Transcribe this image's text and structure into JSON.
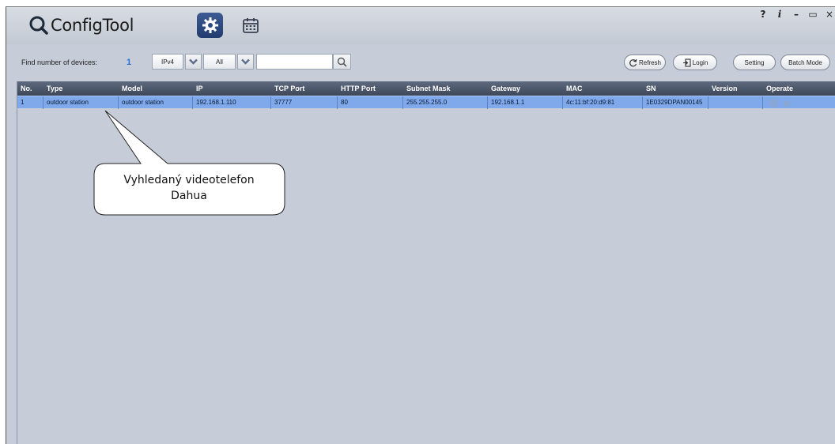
{
  "app": {
    "title": "ConfigTool",
    "window_controls": [
      "?",
      "i",
      "–",
      "▭",
      "×"
    ]
  },
  "toolbar": {
    "find_label": "Find number of devices:",
    "find_count": "1",
    "ip_type": "IPv4",
    "filter": "All",
    "search_value": "",
    "buttons": {
      "refresh": "Refresh",
      "login": "Login",
      "setting": "Setting",
      "batch_mode": "Batch Mode"
    }
  },
  "table": {
    "columns": [
      "No.",
      "Type",
      "Model",
      "IP",
      "TCP Port",
      "HTTP Port",
      "Subnet Mask",
      "Gateway",
      "MAC",
      "SN",
      "Version",
      "Operate"
    ],
    "rows": [
      {
        "no": "1",
        "type": "outdoor station",
        "model": "outdoor station",
        "ip": "192.168.1.110",
        "tcp_port": "37777",
        "http_port": "80",
        "subnet_mask": "255.255.255.0",
        "gateway": "192.168.1.1",
        "mac": "4c:11:bf:20:d9:81",
        "sn": "1E0329DPAN00145",
        "version": "",
        "operate_icons": [
          "gear-icon",
          "browser-e-icon"
        ]
      }
    ]
  },
  "callout": {
    "line1": "Vyhledaný videotelefon",
    "line2": "Dahua"
  },
  "colors": {
    "background": "#c6cdd8",
    "header": "#4a5568",
    "selected_row": "#7fa9ea",
    "accent_tab": "#2c4a82",
    "count": "#2a70d8"
  }
}
